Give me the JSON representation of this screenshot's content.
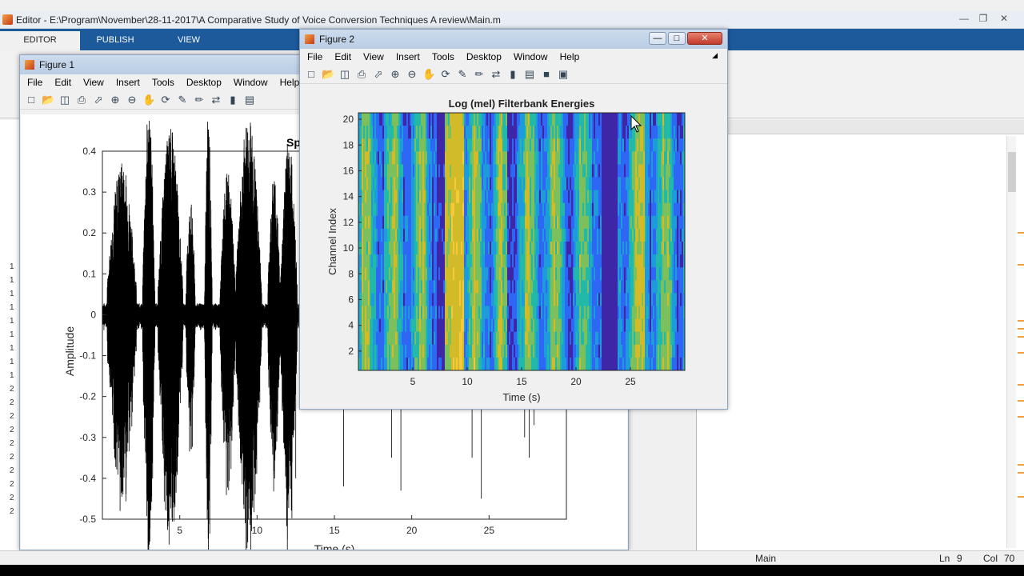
{
  "editor": {
    "title": "Editor - E:\\Program\\November\\28-11-2017\\A Comparative Study of Voice Conversion Techniques A review\\Main.m",
    "tabs": [
      "EDITOR",
      "PUBLISH",
      "VIEW"
    ]
  },
  "status": {
    "function_name": "Main",
    "ln_label": "Ln",
    "ln_value": "9",
    "col_label": "Col",
    "col_value": "70"
  },
  "figure1": {
    "title": "Figure 1",
    "menu": [
      "File",
      "Edit",
      "View",
      "Insert",
      "Tools",
      "Desktop",
      "Window",
      "Help"
    ],
    "plot_title": "Sp",
    "chart_data": {
      "type": "line",
      "title": "Sp",
      "xlabel": "Time (s)",
      "ylabel": "Amplitude",
      "xlim": [
        0,
        30
      ],
      "ylim": [
        -0.5,
        0.4
      ],
      "xticks": [
        "5",
        "10",
        "15",
        "20",
        "25"
      ],
      "yticks": [
        "0.4",
        "0.3",
        "0.2",
        "0.1",
        "0",
        "-0.1",
        "-0.2",
        "-0.3",
        "-0.4",
        "-0.5"
      ],
      "series": [
        {
          "values": []
        }
      ]
    }
  },
  "figure2": {
    "title": "Figure 2",
    "menu": [
      "File",
      "Edit",
      "View",
      "Insert",
      "Tools",
      "Desktop",
      "Window",
      "Help"
    ],
    "chart_data": {
      "type": "heatmap",
      "title": "Log (mel) Filterbank Energies",
      "xlabel": "Time (s)",
      "ylabel": "Channel Index",
      "xlim": [
        0,
        30
      ],
      "ylim": [
        0.5,
        20.5
      ],
      "xticks": [
        "5",
        "10",
        "15",
        "20",
        "25"
      ],
      "yticks": [
        "20",
        "18",
        "16",
        "14",
        "12",
        "10",
        "8",
        "6",
        "4",
        "2"
      ],
      "colormap": [
        "#3e26a8",
        "#2f67f5",
        "#1d9bda",
        "#23b9a9",
        "#7bc05d",
        "#d1bb29",
        "#f6c93a"
      ]
    }
  },
  "colors": {
    "ribbon": "#1d5a9c",
    "signal": "#000000"
  }
}
